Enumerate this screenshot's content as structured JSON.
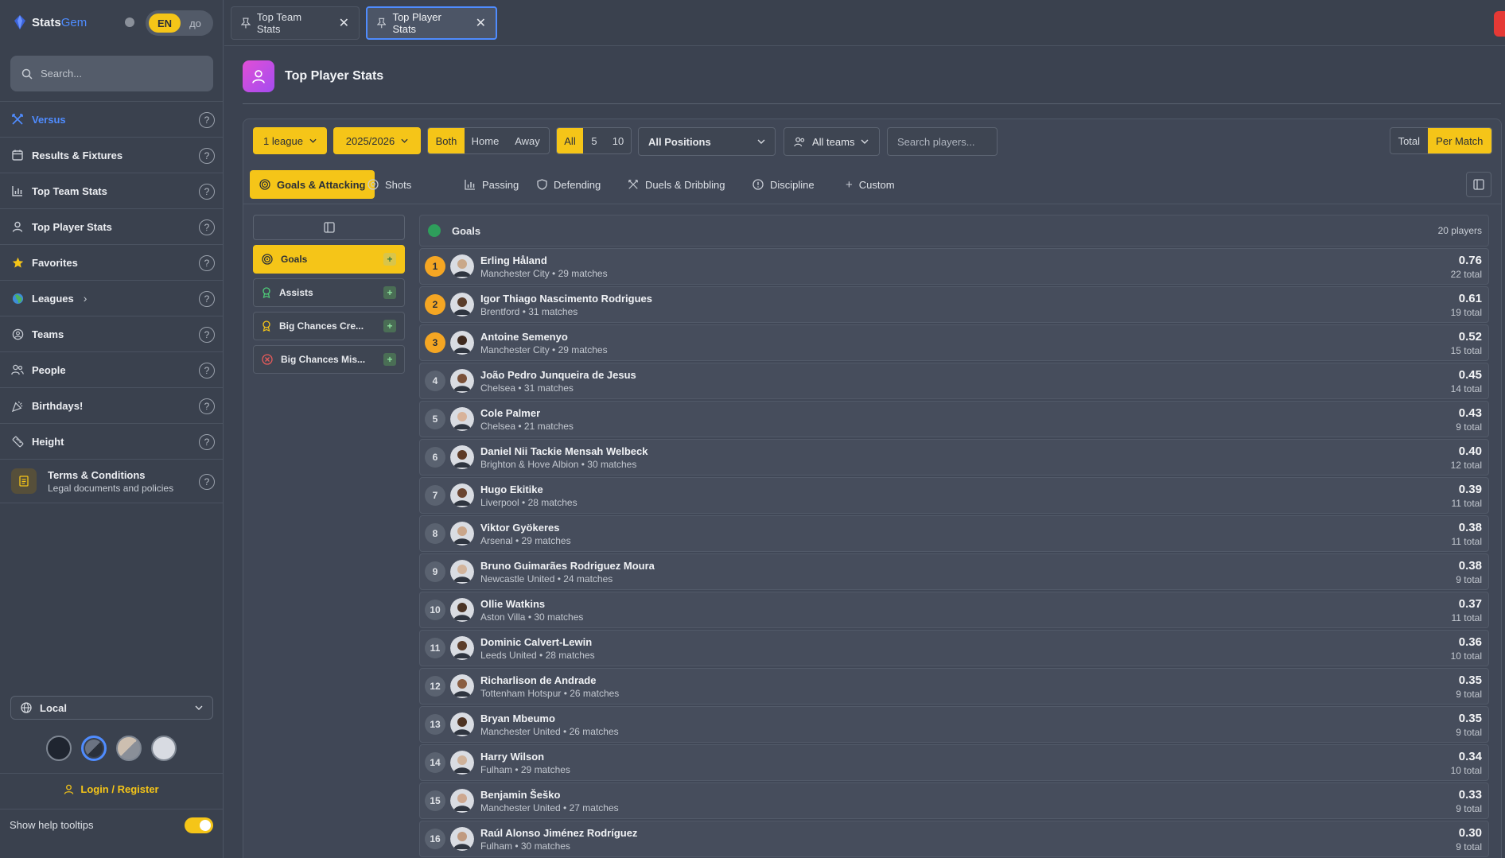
{
  "brand": {
    "name_a": "Stats",
    "name_b": "Gem"
  },
  "lang": {
    "active": "EN",
    "alt": "до"
  },
  "search": {
    "placeholder": "Search..."
  },
  "nav": [
    {
      "label": "Versus",
      "icon": "versus-icon",
      "active": true
    },
    {
      "label": "Results & Fixtures",
      "icon": "calendar-icon"
    },
    {
      "label": "Top Team Stats",
      "icon": "bar-chart-icon"
    },
    {
      "label": "Top Player Stats",
      "icon": "user-icon"
    },
    {
      "label": "Favorites",
      "icon": "star-icon"
    },
    {
      "label": "Leagues",
      "icon": "globe-icon"
    },
    {
      "label": "Teams",
      "icon": "teams-icon"
    },
    {
      "label": "People",
      "icon": "people-icon"
    },
    {
      "label": "Birthdays!",
      "icon": "party-icon"
    },
    {
      "label": "Height",
      "icon": "ruler-icon"
    }
  ],
  "terms": {
    "title": "Terms & Conditions",
    "subtitle": "Legal documents and policies"
  },
  "locale": {
    "label": "Local"
  },
  "login": {
    "label": "Login / Register"
  },
  "tooltips": {
    "label": "Show help tooltips",
    "enabled": true
  },
  "tabs": [
    {
      "label": "Top Team Stats",
      "active": false
    },
    {
      "label": "Top Player Stats",
      "active": true
    }
  ],
  "page": {
    "title": "Top Player Stats"
  },
  "filters": {
    "league": "1 league",
    "season": "2025/2026",
    "venue": [
      "Both",
      "Home",
      "Away"
    ],
    "venue_selected": "Both",
    "range": [
      "All",
      "5",
      "10"
    ],
    "range_selected": "All",
    "positions": "All Positions",
    "teams": "All teams",
    "player_search_placeholder": "Search players...",
    "mode": [
      "Total",
      "Per Match"
    ],
    "mode_selected": "Per Match"
  },
  "categories": [
    "Goals & Attacking",
    "Shots",
    "Passing",
    "Defending",
    "Duels & Dribbling",
    "Discipline",
    "Custom"
  ],
  "category_selected": "Goals & Attacking",
  "stats": [
    "Goals",
    "Assists",
    "Big Chances Cre...",
    "Big Chances Mis..."
  ],
  "stat_selected": "Goals",
  "list": {
    "title": "Goals",
    "count": "20 players"
  },
  "players": [
    {
      "rank": "1",
      "name": "Erling Håland",
      "meta": "Manchester City • 29 matches",
      "value": "0.76",
      "total": "22 total"
    },
    {
      "rank": "2",
      "name": "Igor Thiago Nascimento Rodrigues",
      "meta": "Brentford • 31 matches",
      "value": "0.61",
      "total": "19 total"
    },
    {
      "rank": "3",
      "name": "Antoine Semenyo",
      "meta": "Manchester City • 29 matches",
      "value": "0.52",
      "total": "15 total"
    },
    {
      "rank": "4",
      "name": "João Pedro Junqueira de Jesus",
      "meta": "Chelsea • 31 matches",
      "value": "0.45",
      "total": "14 total"
    },
    {
      "rank": "5",
      "name": "Cole Palmer",
      "meta": "Chelsea • 21 matches",
      "value": "0.43",
      "total": "9 total"
    },
    {
      "rank": "6",
      "name": "Daniel Nii Tackie Mensah Welbeck",
      "meta": "Brighton & Hove Albion • 30 matches",
      "value": "0.40",
      "total": "12 total"
    },
    {
      "rank": "7",
      "name": "Hugo Ekitike",
      "meta": "Liverpool • 28 matches",
      "value": "0.39",
      "total": "11 total"
    },
    {
      "rank": "8",
      "name": "Viktor Gyökeres",
      "meta": "Arsenal • 29 matches",
      "value": "0.38",
      "total": "11 total"
    },
    {
      "rank": "9",
      "name": "Bruno Guimarães Rodriguez Moura",
      "meta": "Newcastle United • 24 matches",
      "value": "0.38",
      "total": "9 total"
    },
    {
      "rank": "10",
      "name": "Ollie Watkins",
      "meta": "Aston Villa • 30 matches",
      "value": "0.37",
      "total": "11 total"
    },
    {
      "rank": "11",
      "name": "Dominic Calvert-Lewin",
      "meta": "Leeds United • 28 matches",
      "value": "0.36",
      "total": "10 total"
    },
    {
      "rank": "12",
      "name": "Richarlison de Andrade",
      "meta": "Tottenham Hotspur • 26 matches",
      "value": "0.35",
      "total": "9 total"
    },
    {
      "rank": "13",
      "name": "Bryan Mbeumo",
      "meta": "Manchester United • 26 matches",
      "value": "0.35",
      "total": "9 total"
    },
    {
      "rank": "14",
      "name": "Harry Wilson",
      "meta": "Fulham • 29 matches",
      "value": "0.34",
      "total": "10 total"
    },
    {
      "rank": "15",
      "name": "Benjamin Šeško",
      "meta": "Manchester United • 27 matches",
      "value": "0.33",
      "total": "9 total"
    },
    {
      "rank": "16",
      "name": "Raúl Alonso Jiménez Rodríguez",
      "meta": "Fulham • 30 matches",
      "value": "0.30",
      "total": "9 total"
    }
  ],
  "colors": {
    "accent": "#f5c518",
    "link": "#4f8cff",
    "rank_top": "#f5a623"
  }
}
